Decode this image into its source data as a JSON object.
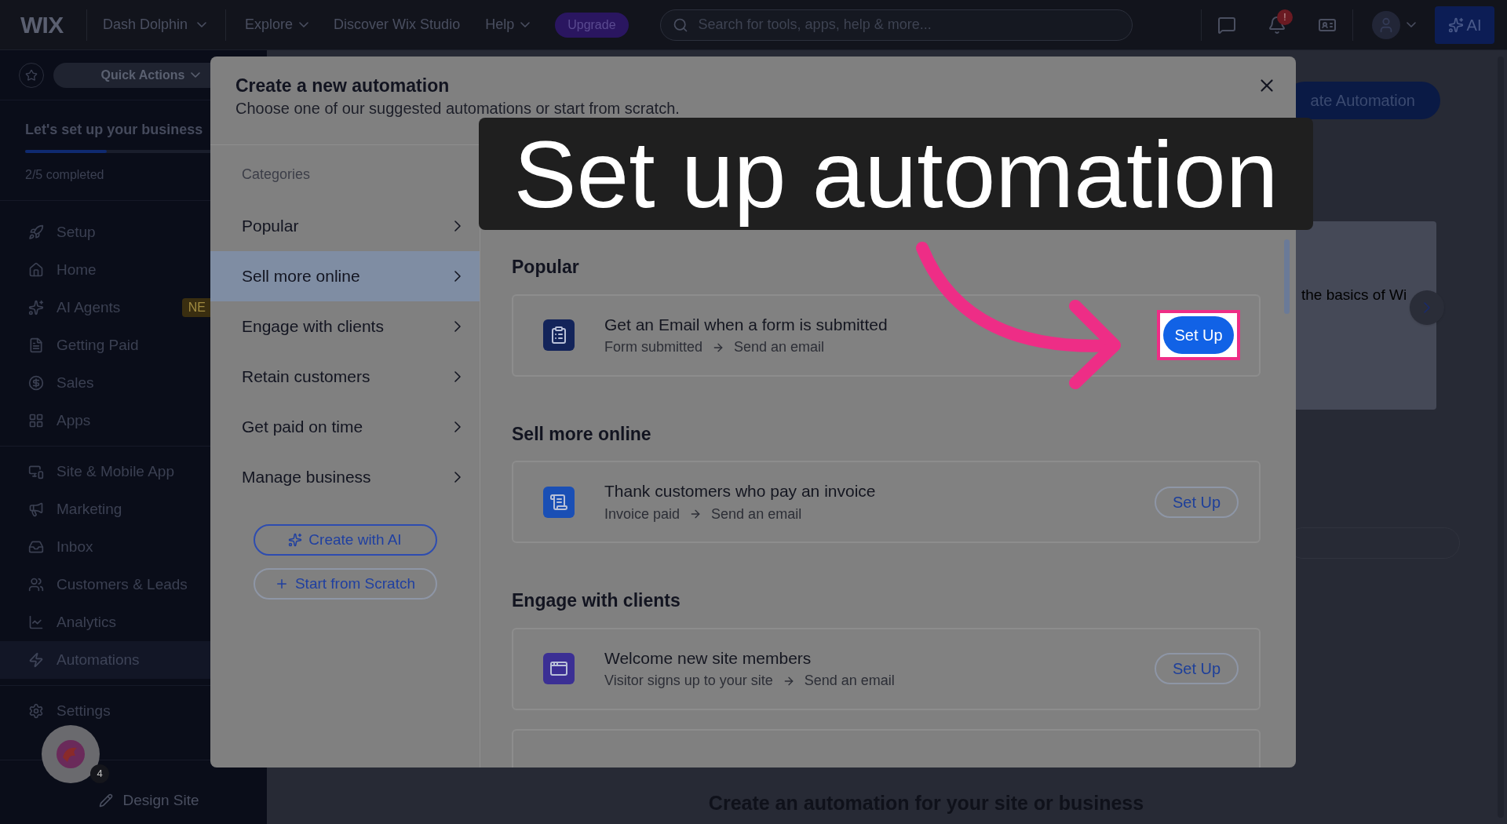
{
  "top_bar": {
    "logo": "WIX",
    "site_name": "Dash Dolphin",
    "nav": [
      {
        "label": "Explore",
        "dropdown": true
      },
      {
        "label": "Discover Wix Studio",
        "dropdown": false
      },
      {
        "label": "Help",
        "dropdown": true
      }
    ],
    "upgrade": "Upgrade",
    "search_placeholder": "Search for tools, apps, help & more...",
    "notification_badge": "!",
    "ai_button": "AI"
  },
  "sidebar": {
    "quick_actions": "Quick Actions",
    "setup": {
      "title": "Let's set up your business",
      "level": 0.4,
      "caption": "2/5 completed"
    },
    "groups": [
      {
        "items": [
          {
            "label": "Setup",
            "selected": false
          },
          {
            "label": "Home",
            "selected": false
          },
          {
            "label": "AI Agents",
            "selected": false,
            "badge": "NE"
          },
          {
            "label": "Getting Paid",
            "selected": false
          },
          {
            "label": "Sales",
            "selected": false
          },
          {
            "label": "Apps",
            "selected": false
          }
        ]
      },
      {
        "items": [
          {
            "label": "Site & Mobile App",
            "selected": false
          },
          {
            "label": "Marketing",
            "selected": false
          },
          {
            "label": "Inbox",
            "selected": false
          },
          {
            "label": "Customers & Leads",
            "selected": false
          },
          {
            "label": "Analytics",
            "selected": false
          },
          {
            "label": "Automations",
            "selected": true
          }
        ]
      },
      {
        "items": [
          {
            "label": "Settings",
            "selected": false
          }
        ]
      }
    ],
    "assistant_badge": "4",
    "design_site": "Design Site"
  },
  "background_page": {
    "create_button": "ate Automation",
    "card_text": "the basics of Wi",
    "footer_heading": "Create an automation for your site or business"
  },
  "modal": {
    "title": "Create a new automation",
    "subtitle": "Choose one of our suggested automations or start from scratch.",
    "categories_label": "Categories",
    "categories": [
      {
        "label": "Popular",
        "selected": false
      },
      {
        "label": "Sell more online",
        "selected": true
      },
      {
        "label": "Engage with clients",
        "selected": false
      },
      {
        "label": "Retain customers",
        "selected": false
      },
      {
        "label": "Get paid on time",
        "selected": false
      },
      {
        "label": "Manage business",
        "selected": false
      }
    ],
    "create_with_ai": "Create with AI",
    "start_from_scratch": "Start from Scratch",
    "sections": [
      {
        "heading": "Popular",
        "cards": [
          {
            "title": "Get an Email when a form is submitted",
            "trigger": "Form submitted",
            "action": "Send an email",
            "button": "Set Up",
            "highlighted": true
          }
        ]
      },
      {
        "heading": "Sell more online",
        "cards": [
          {
            "title": "Thank customers who pay an invoice",
            "trigger": "Invoice paid",
            "action": "Send an email",
            "button": "Set Up",
            "highlighted": false
          }
        ]
      },
      {
        "heading": "Engage with clients",
        "cards": [
          {
            "title": "Welcome new site members",
            "trigger": "Visitor signs up to your site",
            "action": "Send an email",
            "button": "Set Up",
            "highlighted": false
          }
        ]
      }
    ]
  },
  "caption": "Set up automation"
}
